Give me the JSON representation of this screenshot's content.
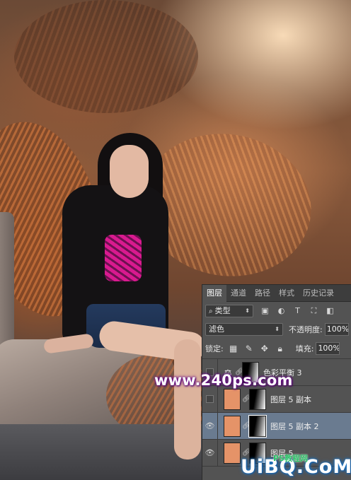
{
  "watermark": {
    "text": "www.240ps.com"
  },
  "brand_logo": {
    "text": "UiBQ.CoM",
    "sub": "PS教程网"
  },
  "layers_panel": {
    "tabs": [
      {
        "label": "图层",
        "active": true
      },
      {
        "label": "通道",
        "active": false
      },
      {
        "label": "路径",
        "active": false
      },
      {
        "label": "样式",
        "active": false
      },
      {
        "label": "历史记录",
        "active": false
      }
    ],
    "filter": {
      "label": "类型",
      "icon": "search-icon"
    },
    "filter_icons": [
      "image-filter-icon",
      "adjustment-filter-icon",
      "type-filter-icon",
      "shape-filter-icon",
      "smart-object-filter-icon"
    ],
    "blend_mode": "滤色",
    "opacity_label": "不透明度:",
    "opacity_value": "100%",
    "lock_label": "锁定:",
    "lock_icons": [
      "lock-transparent-icon",
      "lock-paint-icon",
      "lock-move-icon",
      "lock-all-icon"
    ],
    "fill_label": "填充:",
    "fill_value": "100%",
    "layers": [
      {
        "name": "色彩平衡 3",
        "visible": false,
        "thumb": "adjustment",
        "selected": false
      },
      {
        "name": "图层 5 副本",
        "visible": false,
        "thumb": "#e59368",
        "selected": false
      },
      {
        "name": "图层 5 副本 2",
        "visible": true,
        "thumb": "#e59368",
        "selected": true
      },
      {
        "name": "图层 5",
        "visible": true,
        "thumb": "#e59368",
        "selected": false
      }
    ]
  },
  "colors": {
    "panel_bg": "#535353",
    "tab_bar_bg": "#3d3d3d",
    "selected_layer": "#6a7b90",
    "thumb_fill": "#e59368",
    "watermark_glow": "#6a0a8a"
  }
}
